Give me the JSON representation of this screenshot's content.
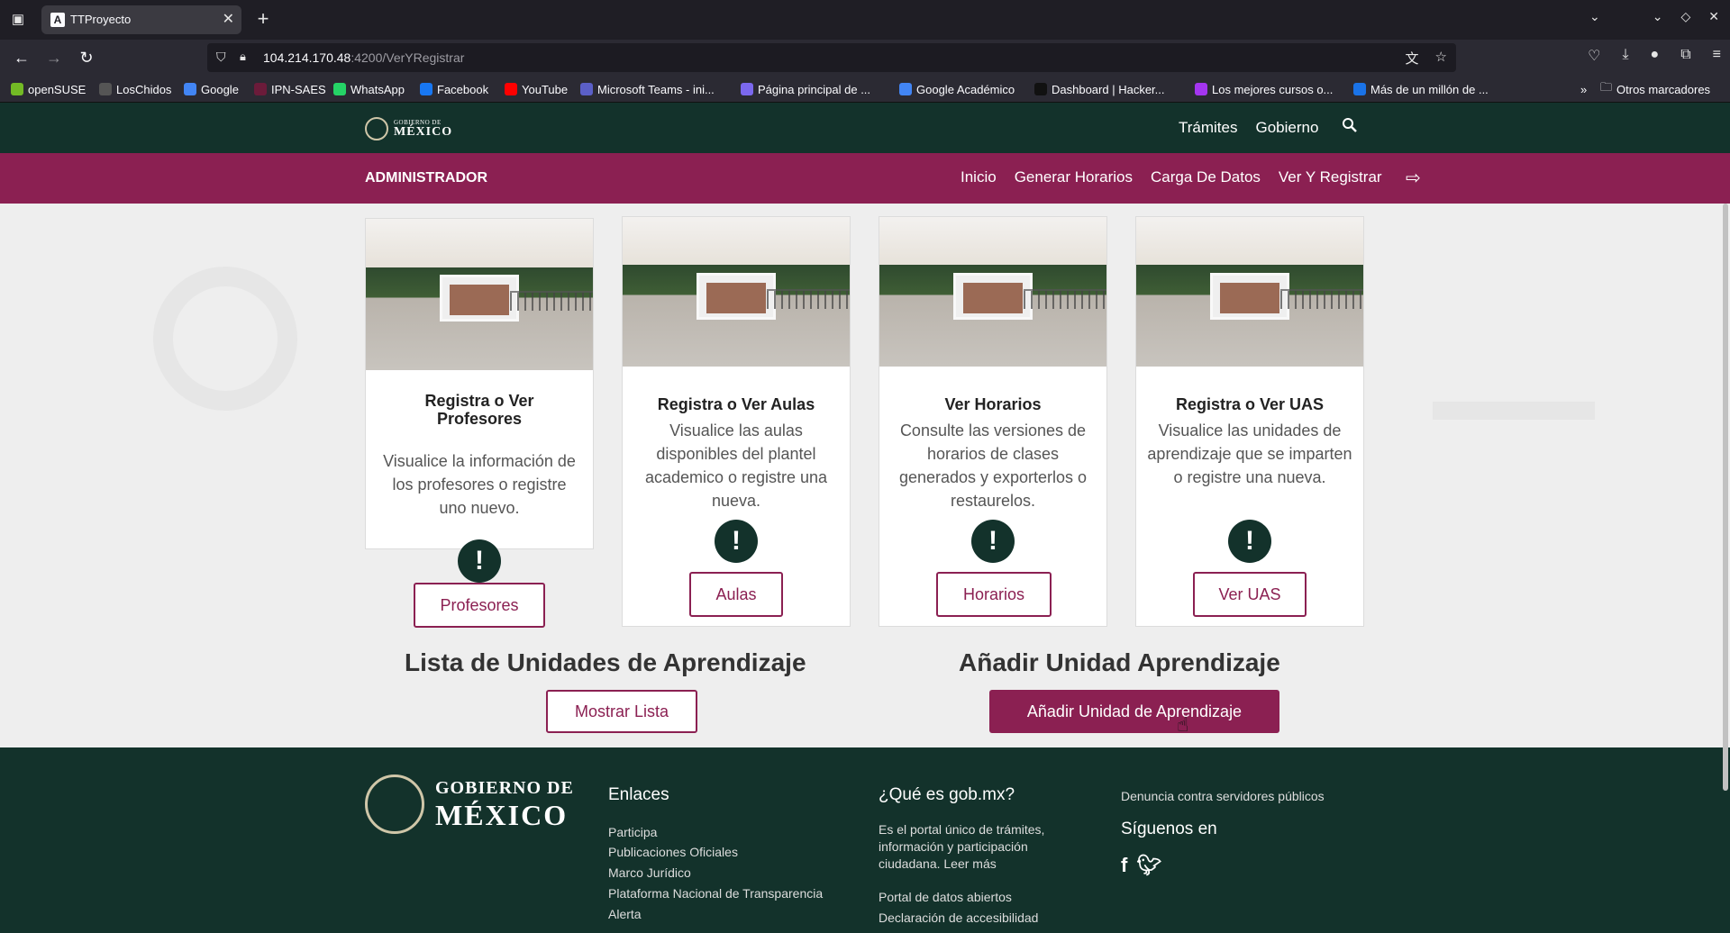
{
  "browser": {
    "tab_title": "TTProyecto",
    "url_host": "104.214.170.48",
    "url_path": ":4200/VerYRegistrar",
    "bookmarks": [
      {
        "label": "openSUSE",
        "color": "#73ba25"
      },
      {
        "label": "LosChidos",
        "color": "#555555"
      },
      {
        "label": "Google",
        "color": "#4285f4"
      },
      {
        "label": "IPN-SAES",
        "color": "#6b1b3a"
      },
      {
        "label": "WhatsApp",
        "color": "#25d366"
      },
      {
        "label": "Facebook",
        "color": "#1877f2"
      },
      {
        "label": "YouTube",
        "color": "#ff0000"
      },
      {
        "label": "Microsoft Teams - ini...",
        "color": "#5b5fc7"
      },
      {
        "label": "Página principal de ...",
        "color": "#7b68ee"
      },
      {
        "label": "Google Académico",
        "color": "#4285f4"
      },
      {
        "label": "Dashboard | Hacker...",
        "color": "#111111"
      },
      {
        "label": "Los mejores cursos o...",
        "color": "#a435f0"
      },
      {
        "label": "Más de un millón de ...",
        "color": "#1a73e8"
      }
    ],
    "other_bookmarks": "Otros marcadores"
  },
  "header": {
    "logo_line1": "GOBIERNO DE",
    "logo_line2": "MÉXICO",
    "links": [
      "Trámites",
      "Gobierno"
    ]
  },
  "subheader": {
    "role": "ADMINISTRADOR",
    "links": [
      "Inicio",
      "Generar Horarios",
      "Carga De Datos",
      "Ver Y Registrar"
    ]
  },
  "cards": [
    {
      "title": "Registra o Ver Profesores",
      "desc": "Visualice la información de los profesores o registre uno nuevo.",
      "button": "Profesores"
    },
    {
      "title": "Registra o Ver Aulas",
      "desc": "Visualice las aulas disponibles del plantel academico o registre una nueva.",
      "button": "Aulas"
    },
    {
      "title": "Ver Horarios",
      "desc": "Consulte las versiones de horarios de clases generados y exporterlos o restaurelos.",
      "button": "Horarios"
    },
    {
      "title": "Registra o Ver UAS",
      "desc": "Visualice las unidades de aprendizaje que se imparten o registre una nueva.",
      "button": "Ver UAS"
    }
  ],
  "sections": {
    "list_title": "Lista de Unidades de Aprendizaje",
    "list_button": "Mostrar Lista",
    "add_title": "Añadir Unidad Aprendizaje",
    "add_button": "Añadir Unidad de Aprendizaje"
  },
  "footer": {
    "logo_line1": "GOBIERNO DE",
    "logo_line2": "MÉXICO",
    "enlaces_title": "Enlaces",
    "enlaces": [
      "Participa",
      "Publicaciones Oficiales",
      "Marco Jurídico",
      "Plataforma Nacional de Transparencia",
      "Alerta"
    ],
    "que_es_title": "¿Qué es gob.mx?",
    "que_es_text": "Es el portal único de trámites, información y participación ciudadana. Leer más",
    "que_es_links": [
      "Portal de datos abiertos",
      "Declaración de accesibilidad"
    ],
    "denuncia": "Denuncia contra servidores públicos",
    "siguenos": "Síguenos en"
  }
}
